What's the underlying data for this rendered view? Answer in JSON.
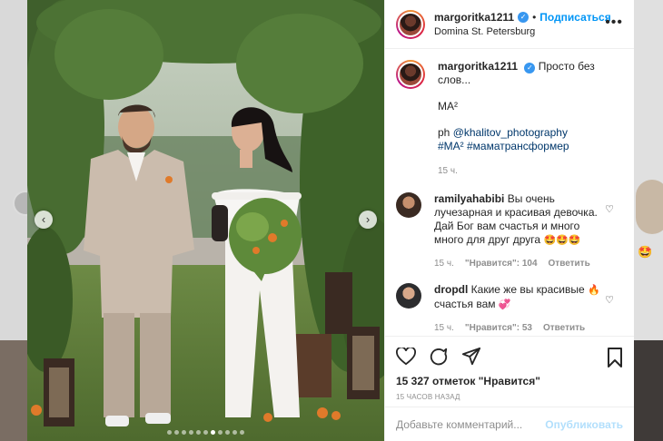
{
  "post": {
    "username": "margoritka1211",
    "separator": "•",
    "follow_label": "Подписаться",
    "location": "Domina St. Petersburg",
    "more_icon": "more-horizontal-icon"
  },
  "caption": {
    "username": "margoritka1211",
    "headline": "Просто без слов...",
    "line_title": "MA²",
    "credit_prefix": "ph ",
    "credit_handle": "@khalitov_photography",
    "hashtags": "#MA² #маматрансформер",
    "time": "15 ч."
  },
  "comments": [
    {
      "username": "ramilyahabibi",
      "text": "Вы очень лучезарная и красивая девочка. Дай Бог вам счастья и много много для друг друга",
      "emoji": "🤩🤩🤩",
      "time": "15 ч.",
      "likes": "\"Нравится\": 104",
      "reply": "Ответить"
    },
    {
      "username": "dropdl",
      "text": "Какие же вы красивые",
      "emoji_mid": "🔥",
      "text2": "счастья вам",
      "emoji_end": "💞",
      "time": "15 ч.",
      "likes": "\"Нравится\": 53",
      "reply": "Ответить"
    }
  ],
  "stats": {
    "likes": "15 327 отметок \"Нравится\"",
    "ago": "15 ЧАСОВ НАЗАД"
  },
  "composer": {
    "placeholder": "Добавьте комментарий...",
    "publish": "Опубликовать"
  },
  "carousel": {
    "dot_count": 11,
    "active_index": 6,
    "prev_icon": "chevron-left-icon",
    "next_icon": "chevron-right-icon"
  },
  "colors": {
    "accent": "#0095f6",
    "publish_disabled": "#b2dffc",
    "verified": "#3897f0"
  }
}
